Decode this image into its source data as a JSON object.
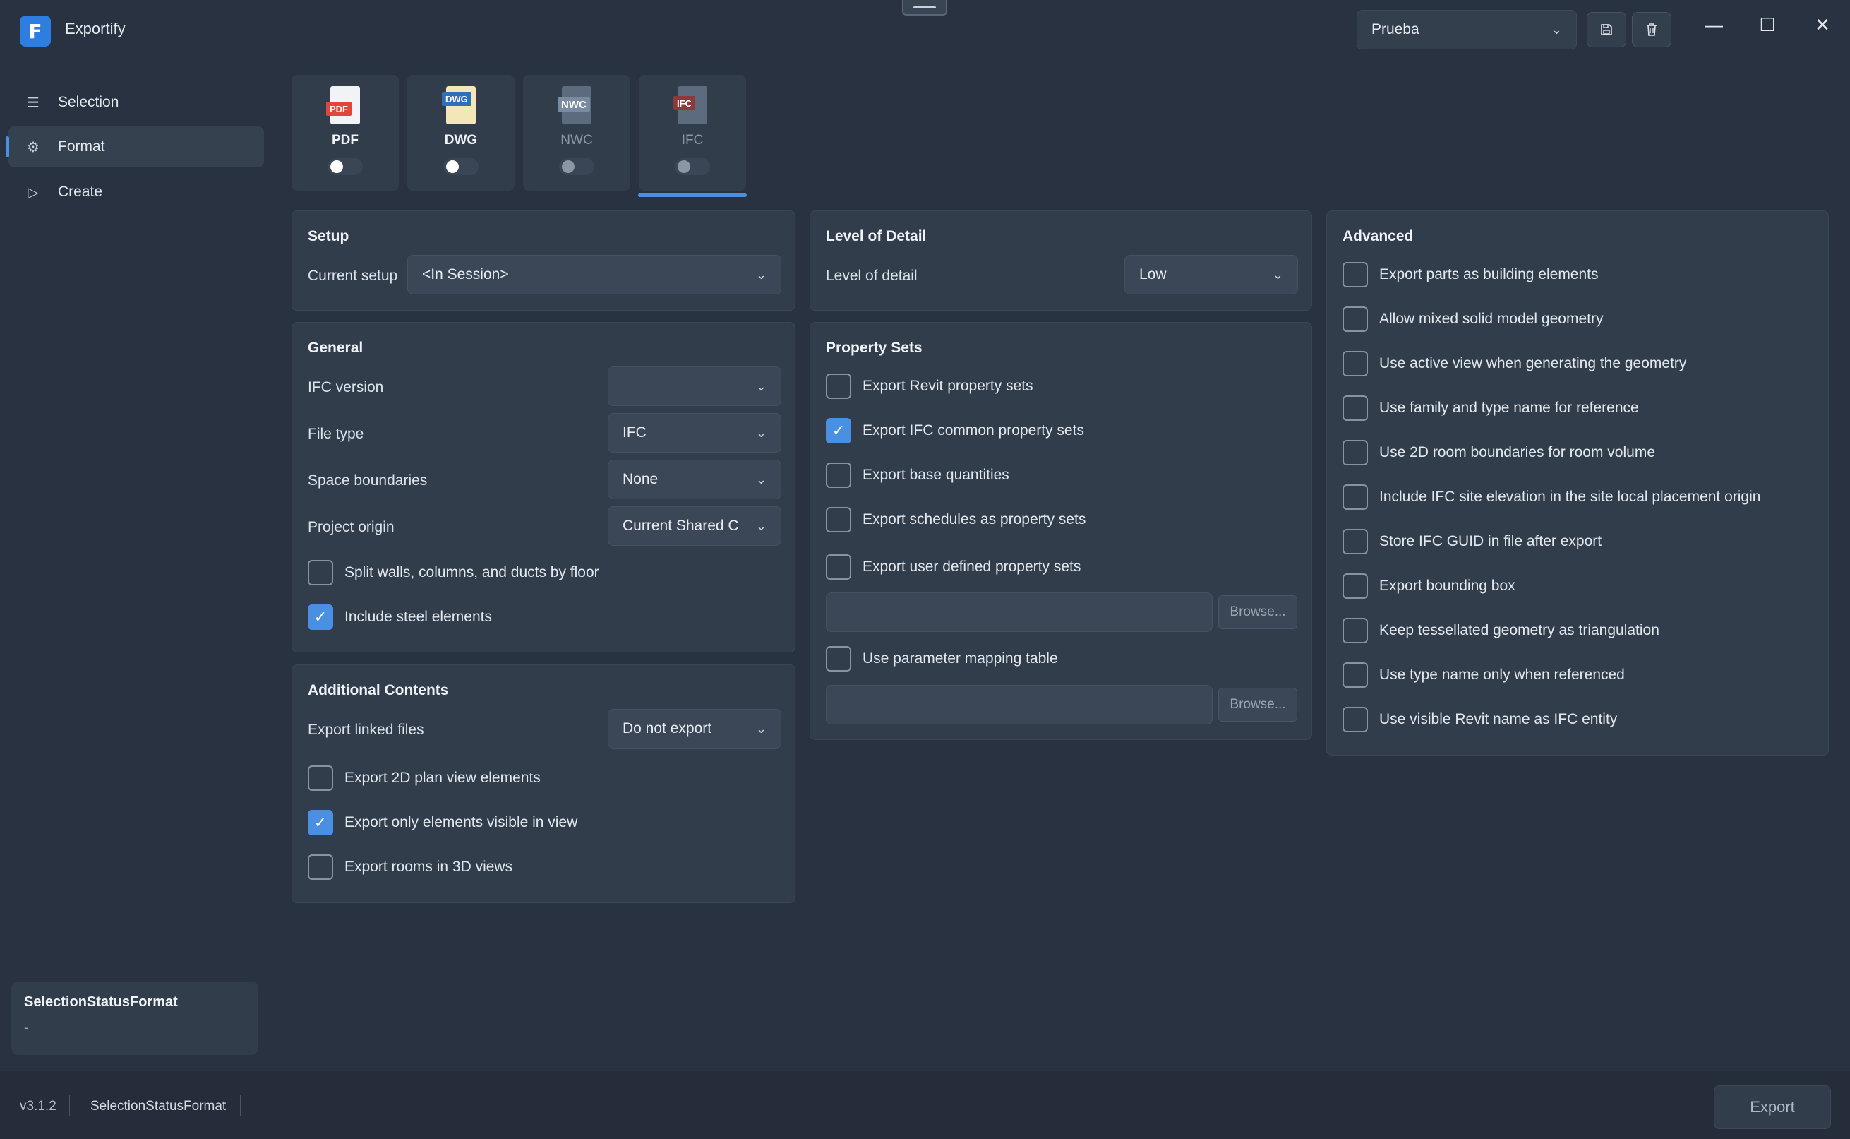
{
  "app": {
    "title": "Exportify",
    "logo_letter": "F"
  },
  "titlebar": {
    "profile": "Prueba",
    "save_icon": "save-icon",
    "delete_icon": "trash-icon",
    "minimize": "—",
    "maximize": "☐",
    "close": "✕"
  },
  "sidebar": {
    "items": [
      {
        "label": "Selection",
        "icon": "☰"
      },
      {
        "label": "Format",
        "icon": "⚙"
      },
      {
        "label": "Create",
        "icon": "▷"
      }
    ],
    "status_card": {
      "title": "SelectionStatusFormat",
      "value": "-"
    }
  },
  "formats": [
    {
      "label": "PDF",
      "tag": "PDF",
      "color": "#e0463c",
      "enabled": false
    },
    {
      "label": "DWG",
      "tag": "DWG",
      "color": "#2e6fb8",
      "enabled": false
    },
    {
      "label": "NWC",
      "tag": "NWC",
      "color": "#7a8aa0",
      "enabled": false
    },
    {
      "label": "IFC",
      "tag": "IFC",
      "color": "#c0392b",
      "enabled": false
    }
  ],
  "setup": {
    "title": "Setup",
    "current_setup_label": "Current setup",
    "current_setup_value": "<In Session>"
  },
  "general": {
    "title": "General",
    "ifc_version_label": "IFC version",
    "ifc_version_value": "",
    "file_type_label": "File type",
    "file_type_value": "IFC",
    "space_boundaries_label": "Space boundaries",
    "space_boundaries_value": "None",
    "project_origin_label": "Project origin",
    "project_origin_value": "Current Shared C",
    "split_walls": "Split walls, columns, and ducts by floor",
    "include_steel": "Include steel elements"
  },
  "additional": {
    "title": "Additional Contents",
    "linked_files_label": "Export linked files",
    "linked_files_value": "Do not export",
    "plan_view": "Export 2D plan view elements",
    "visible_only": "Export only elements visible in view",
    "rooms_3d": "Export rooms in 3D views"
  },
  "lod": {
    "title": "Level of Detail",
    "label": "Level of detail",
    "value": "Low"
  },
  "property_sets": {
    "title": "Property Sets",
    "revit": "Export Revit property sets",
    "ifc_common": "Export IFC common property sets",
    "base_quantities": "Export base quantities",
    "schedules": "Export schedules as property sets",
    "user_defined": "Export user defined property sets",
    "browse1": "Browse...",
    "param_mapping": "Use parameter mapping table",
    "browse2": "Browse..."
  },
  "advanced": {
    "title": "Advanced",
    "items": [
      "Export parts as building elements",
      "Allow mixed solid model geometry",
      "Use active view when generating the geometry",
      "Use family and type name for reference",
      "Use 2D room boundaries for room volume",
      "Include IFC site elevation in the site local placement origin",
      "Store IFC GUID in file after export",
      "Export bounding box",
      "Keep tessellated geometry as triangulation",
      "Use type name only when referenced",
      "Use visible Revit name as IFC entity"
    ]
  },
  "footer": {
    "version": "v3.1.2",
    "status": "SelectionStatusFormat",
    "export": "Export"
  },
  "colors": {
    "accent": "#4a90e2",
    "background": "#283240",
    "panel": "#323d4b"
  }
}
